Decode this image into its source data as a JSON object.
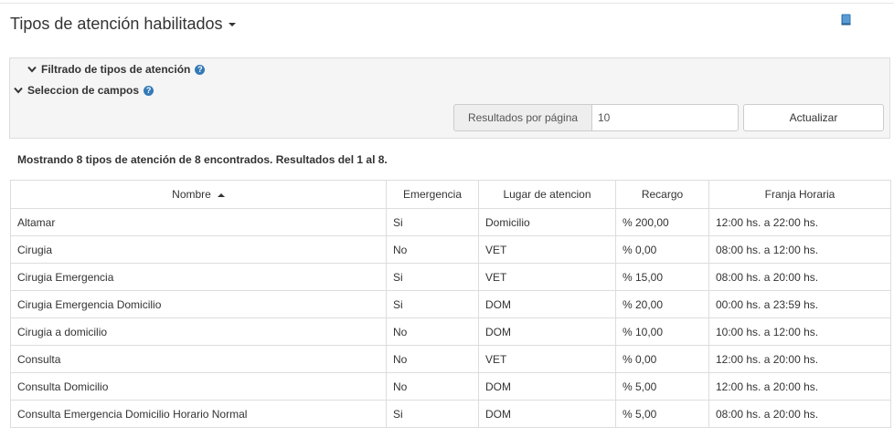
{
  "page": {
    "title": "Tipos de atención habilitados"
  },
  "filters": {
    "filter_toggle_label": "Filtrado de tipos de atención",
    "fields_toggle_label": "Seleccion de campos",
    "help_glyph": "?",
    "results_per_page_label": "Resultados por página",
    "results_per_page_value": "10",
    "update_button_label": "Actualizar"
  },
  "summary": {
    "text": "Mostrando 8 tipos de atención de 8 encontrados. Resultados del 1 al 8."
  },
  "table": {
    "columns": [
      "Nombre",
      "Emergencia",
      "Lugar de atencion",
      "Recargo",
      "Franja Horaria"
    ],
    "sort": {
      "column": "Nombre",
      "direction": "asc"
    },
    "rows": [
      [
        "Altamar",
        "Si",
        "Domicilio",
        "% 200,00",
        "12:00 hs. a 22:00 hs."
      ],
      [
        "Cirugia",
        "No",
        "VET",
        "% 0,00",
        "08:00 hs. a 12:00 hs."
      ],
      [
        "Cirugia Emergencia",
        "Si",
        "VET",
        "% 15,00",
        "08:00 hs. a 20:00 hs."
      ],
      [
        "Cirugia Emergencia Domicilio",
        "Si",
        "DOM",
        "% 20,00",
        "00:00 hs. a 23:59 hs."
      ],
      [
        "Cirugia a domicilio",
        "No",
        "DOM",
        "% 10,00",
        "10:00 hs. a 12:00 hs."
      ],
      [
        "Consulta",
        "No",
        "VET",
        "% 0,00",
        "12:00 hs. a 20:00 hs."
      ],
      [
        "Consulta Domicilio",
        "No",
        "DOM",
        "% 5,00",
        "12:00 hs. a 20:00 hs."
      ],
      [
        "Consulta Emergencia Domicilio Horario Normal",
        "Si",
        "DOM",
        "% 5,00",
        "08:00 hs. a 20:00 hs."
      ]
    ]
  },
  "colors": {
    "accent": "#337ab7",
    "panel_bg": "#f5f5f5",
    "border": "#dddddd",
    "text": "#333333"
  },
  "icons": {
    "title_dropdown": "caret-down-icon",
    "manual": "book-icon",
    "help": "question-circle-icon",
    "toggle": "chevron-down-icon",
    "sort": "sort-asc-icon"
  }
}
